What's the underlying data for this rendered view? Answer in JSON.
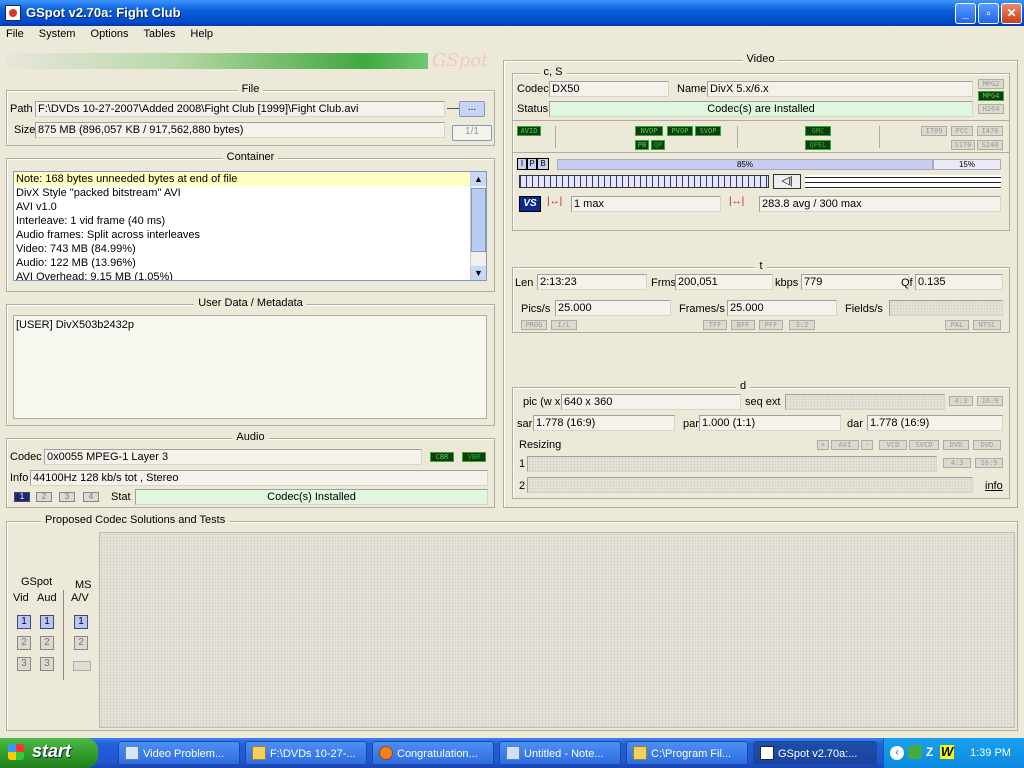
{
  "window": {
    "title": "GSpot v2.70a: Fight Club"
  },
  "menu": [
    "File",
    "System",
    "Options",
    "Tables",
    "Help"
  ],
  "logo_text": "GSpot",
  "file": {
    "title": "File",
    "path_label": "Path",
    "path_value": "F:\\DVDs 10-27-2007\\Added 2008\\Fight Club [1999]\\Fight Club.avi",
    "browse_label": "...",
    "size_label": "Size",
    "size_value": "875 MB (896,057 KB / 917,562,880 bytes)",
    "page_label": "1/1"
  },
  "container": {
    "title": "Container",
    "lines": [
      "Note: 168 bytes unneeded bytes at end of file",
      "DivX Style \"packed bitstream\" AVI",
      "AVI v1.0",
      "Interleave: 1 vid frame (40 ms)",
      "Audio frames: Split across interleaves",
      "Video: 743 MB (84.99%)",
      "Audio: 122 MB (13.96%)",
      "AVI Overhead: 9.15 MB (1.05%)"
    ]
  },
  "userdata": {
    "title": "User Data / Metadata",
    "line": "[USER]    DivX503b2432p"
  },
  "audio": {
    "title": "Audio",
    "codec_label": "Codec",
    "codec_value": "0x0055  MPEG-1 Layer 3",
    "cbr": "CBR",
    "vbr": "VBR",
    "info_label": "Info",
    "info_value": "44100Hz  128 kb/s tot , Stereo",
    "tracks": [
      "1",
      "2",
      "3",
      "4"
    ],
    "stat_label": "Stat",
    "stat_value": "Codec(s) Installed"
  },
  "video": {
    "title": "Video",
    "cs_title": "c, S",
    "codec_label": "Codec",
    "codec_value": "DX50",
    "name_label": "Name",
    "name_value": "DivX 5.x/6.x",
    "status_label": "Status",
    "status_value": "Codec(s) are Installed",
    "tags_right": [
      "MPG2",
      "MPG4",
      "H264"
    ],
    "tag_avid": "AVID",
    "tags_vop": [
      "NVOP",
      "PVOP",
      "SVOP"
    ],
    "tags_pb": [
      "PB",
      "QP"
    ],
    "tags_gmc": [
      "GMC",
      "QPEL"
    ],
    "tags_std": [
      "I709",
      "FCC",
      "I470",
      "S170",
      "S240"
    ],
    "ipb": [
      "I",
      "P",
      "B"
    ],
    "bar_left_pct": "85%",
    "bar_right_pct": "15%",
    "b_frames": "1 max",
    "avg_max": "283.8 avg / 300 max",
    "t_title": "t",
    "len_label": "Len",
    "len_value": "2:13:23",
    "frms_label": "Frms",
    "frms_value": "200,051",
    "kbps_label": "kbps",
    "kbps_value": "779",
    "qf_label": "Qf",
    "qf_value": "0.135",
    "pics_label": "Pics/s",
    "pics_value": "25.000",
    "frames_label": "Frames/s",
    "frames_value": "25.000",
    "fields_label": "Fields/s",
    "t_tags_left": [
      "PROG",
      "I/L"
    ],
    "t_tags_mid": [
      "TFF",
      "BFF",
      "PFF",
      "3:2"
    ],
    "t_tags_right": [
      "PAL",
      "NTSC"
    ],
    "d_title": "d",
    "pic_label": "pic (w x h)",
    "pic_value": "640 x 360",
    "seqext_label": "seq ext",
    "ar_tags": [
      "4:3",
      "16:9"
    ],
    "sar_label": "sar",
    "sar_value": "1.778 (16:9)",
    "par_label": "par",
    "par_value": "1.000 (1:1)",
    "dar_label": "dar",
    "dar_value": "1.778 (16:9)",
    "resizing_label": "Resizing",
    "resize_tags": [
      "+",
      "AVI",
      "-",
      "VCD",
      "SVCD",
      "DVD",
      "DVD"
    ],
    "row1": "1",
    "row2": "2",
    "info_link": "info"
  },
  "proposed": {
    "title": "Proposed Codec Solutions and Tests",
    "gspot_label": "GSpot",
    "ms_label": "MS",
    "vid_label": "Vid",
    "aud_label": "Aud",
    "av_label": "A/V",
    "nums": [
      "1",
      "2",
      "3"
    ]
  },
  "taskbar": {
    "start": "start",
    "tasks": [
      "Video Problem...",
      "F:\\DVDs 10-27-...",
      "Congratulation...",
      "Untitled - Note...",
      "C:\\Program Fil...",
      "GSpot v2.70a:..."
    ],
    "clock": "1:39 PM"
  }
}
